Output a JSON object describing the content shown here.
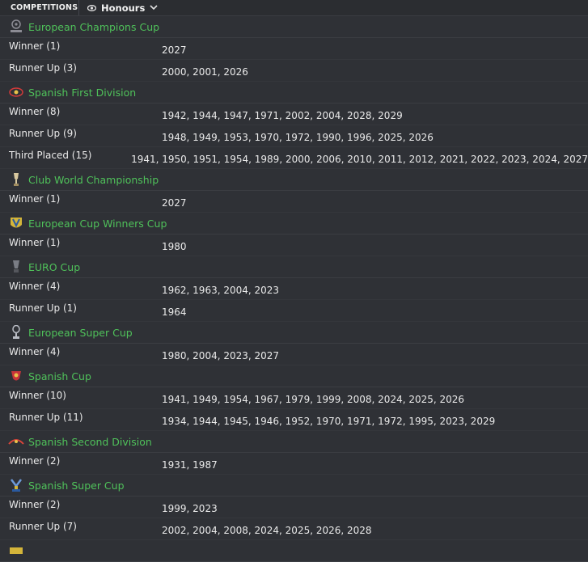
{
  "topbar": {
    "competitions_label": "COMPETITIONS",
    "view_label": "Honours"
  },
  "competitions": [
    {
      "name": "European Champions Cup",
      "icon": "champions-cup-logo",
      "color": "#8c8c94",
      "honours": [
        {
          "label": "Winner  (1)",
          "years": "2027"
        },
        {
          "label": "Runner Up  (3)",
          "years": "2000, 2001, 2026"
        }
      ]
    },
    {
      "name": "Spanish First Division",
      "icon": "spanish-first-division-logo",
      "color": "#d23a3a",
      "honours": [
        {
          "label": "Winner  (8)",
          "years": "1942, 1944, 1947, 1971, 2002, 2004, 2028, 2029"
        },
        {
          "label": "Runner Up  (9)",
          "years": "1948, 1949, 1953, 1970, 1972, 1990, 1996, 2025, 2026"
        },
        {
          "label": "Third Placed  (15)",
          "years": "1941, 1950, 1951, 1954, 1989, 2000, 2006, 2010, 2011, 2012, 2021, 2022, 2023, 2024, 2027"
        }
      ]
    },
    {
      "name": "Club World Championship",
      "icon": "trophy-icon",
      "color": "#d9c9a0",
      "honours": [
        {
          "label": "Winner  (1)",
          "years": "2027"
        }
      ]
    },
    {
      "name": "European Cup Winners Cup",
      "icon": "cup-winners-cup-logo",
      "color": "#d4b53a",
      "honours": [
        {
          "label": "Winner  (1)",
          "years": "1980"
        }
      ]
    },
    {
      "name": "EURO Cup",
      "icon": "euro-cup-logo",
      "color": "#7a7d85",
      "honours": [
        {
          "label": "Winner  (4)",
          "years": "1962, 1963, 2004, 2023"
        },
        {
          "label": "Runner Up  (1)",
          "years": "1964"
        }
      ]
    },
    {
      "name": "European Super Cup",
      "icon": "super-cup-trophy-icon",
      "color": "#b9bcc4",
      "honours": [
        {
          "label": "Winner  (4)",
          "years": "1980, 2004, 2023, 2027"
        }
      ]
    },
    {
      "name": "Spanish Cup",
      "icon": "spanish-cup-logo",
      "color": "#c8343a",
      "honours": [
        {
          "label": "Winner  (10)",
          "years": "1941, 1949, 1954, 1967, 1979, 1999, 2008, 2024, 2025, 2026"
        },
        {
          "label": "Runner Up  (11)",
          "years": "1934, 1944, 1945, 1946, 1952, 1970, 1971, 1972, 1995, 2023, 2029"
        }
      ]
    },
    {
      "name": "Spanish Second Division",
      "icon": "spanish-second-division-logo",
      "color": "#d8453a",
      "honours": [
        {
          "label": "Winner  (2)",
          "years": "1931, 1987"
        }
      ]
    },
    {
      "name": "Spanish Super Cup",
      "icon": "spanish-super-cup-logo",
      "color": "#6d9ad8",
      "honours": [
        {
          "label": "Winner  (2)",
          "years": "1999, 2023"
        },
        {
          "label": "Runner Up  (7)",
          "years": "2002, 2004, 2008, 2024, 2025, 2026, 2028"
        }
      ]
    },
    {
      "name": "",
      "icon": "partial-logo",
      "color": "#d4b53a",
      "honours": []
    }
  ]
}
